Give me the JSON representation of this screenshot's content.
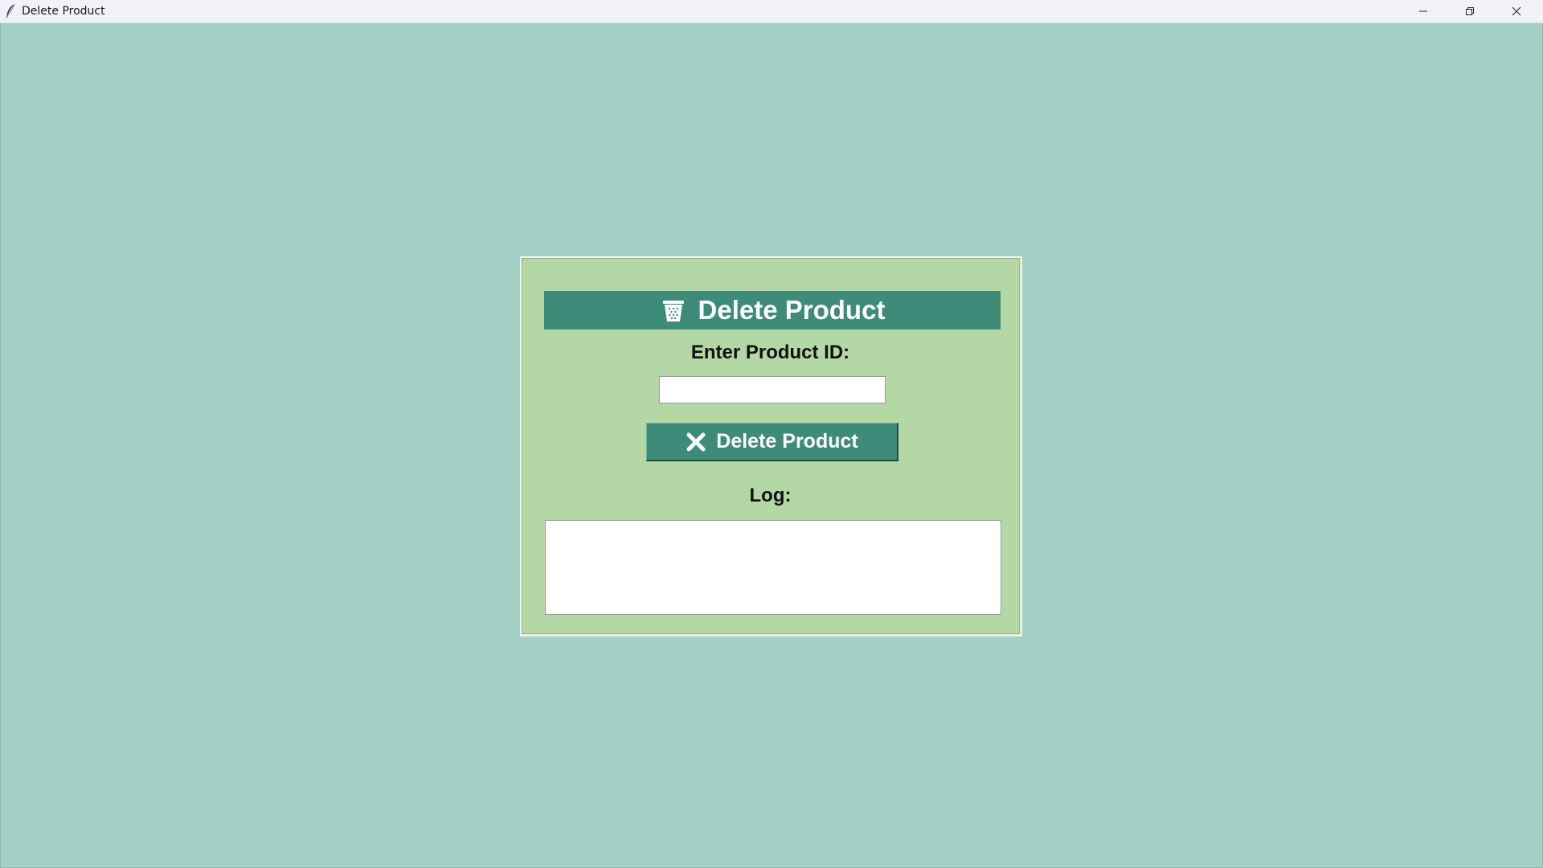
{
  "window": {
    "title": "Delete Product",
    "app_icon": "feather-icon",
    "controls": {
      "minimize_icon": "minimize-icon",
      "maximize_icon": "restore-icon",
      "close_icon": "close-icon"
    }
  },
  "colors": {
    "background": "#a3d1c6",
    "panel": "#b4d8a5",
    "accent": "#3e8b7a",
    "header_text": "#ffffff"
  },
  "panel": {
    "header": {
      "icon": "trash-bin-icon",
      "title": "Delete Product"
    },
    "product_id": {
      "label": "Enter Product ID:",
      "value": "",
      "placeholder": ""
    },
    "delete_button": {
      "icon": "x-mark-icon",
      "label": "Delete Product"
    },
    "log": {
      "label": "Log:",
      "content": ""
    }
  }
}
